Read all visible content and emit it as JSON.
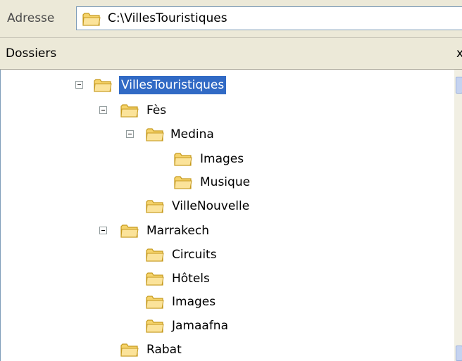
{
  "address_bar": {
    "label": "Adresse",
    "path": "C:\\VillesTouristiques"
  },
  "folders_pane": {
    "title": "Dossiers",
    "close_glyph": "x"
  },
  "tree": [
    {
      "label": "VillesTouristiques",
      "selected": true,
      "expanded": true
    },
    {
      "label": "Fès",
      "expanded": true
    },
    {
      "label": "Medina",
      "expanded": true
    },
    {
      "label": "Images"
    },
    {
      "label": "Musique"
    },
    {
      "label": "VilleNouvelle"
    },
    {
      "label": "Marrakech",
      "expanded": true
    },
    {
      "label": "Circuits"
    },
    {
      "label": "Hôtels"
    },
    {
      "label": "Images"
    },
    {
      "label": "Jamaafna"
    },
    {
      "label": "Rabat"
    }
  ],
  "icons": {
    "folder": "folder-icon",
    "collapse": "minus-box-icon"
  },
  "colors": {
    "selection": "#316ac5",
    "folder_fill": "#f5d36b",
    "folder_edge": "#c69a1e"
  }
}
